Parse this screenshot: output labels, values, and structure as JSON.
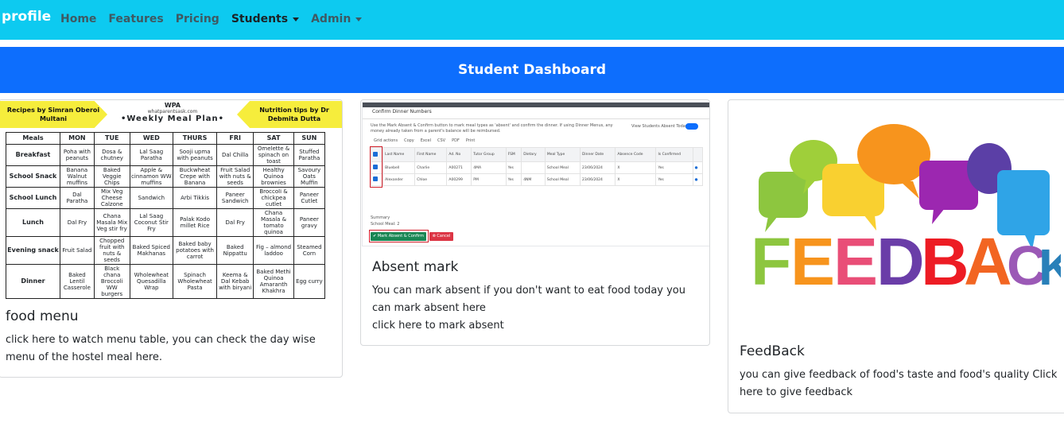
{
  "navbar": {
    "brand": "profile",
    "links": [
      {
        "label": "Home"
      },
      {
        "label": "Features"
      },
      {
        "label": "Pricing"
      },
      {
        "label": "Students"
      },
      {
        "label": "Admin"
      }
    ]
  },
  "banner": {
    "title": "Student Dashboard"
  },
  "cards": [
    {
      "title": "food menu",
      "text": "click here to watch menu table, you can check the day wise menu of the hostel meal here.",
      "image": {
        "left_banner": "Recipes by Simran Oberoi Multani",
        "right_banner": "Nutrition tips by Dr Debmita Dutta",
        "brand": "WPA",
        "site": "whatparentsask.com",
        "plan_title": "•Weekly Meal Plan•",
        "headers": [
          "Meals",
          "MON",
          "TUE",
          "WED",
          "THURS",
          "FRI",
          "SAT",
          "SUN"
        ],
        "rows": [
          [
            "Breakfast",
            "Poha with peanuts",
            "Dosa & chutney",
            "Lal Saag Paratha",
            "Sooji upma with peanuts",
            "Dal Chilla",
            "Omelette & spinach on toast",
            "Stuffed Paratha"
          ],
          [
            "School Snack",
            "Banana Walnut muffins",
            "Baked Veggie Chips",
            "Apple & cinnamon WW muffins",
            "Buckwheat Crepe with Banana",
            "Fruit Salad with nuts & seeds",
            "Healthy Quinoa brownies",
            "Savoury Oats Muffin"
          ],
          [
            "School Lunch",
            "Dal Paratha",
            "Mix Veg Cheese Calzone",
            "Sandwich",
            "Arbi Tikkis",
            "Paneer Sandwich",
            "Broccoli & chickpea cutlet",
            "Paneer Cutlet"
          ],
          [
            "Lunch",
            "Dal Fry",
            "Chana Masala Mix Veg stir fry",
            "Lal Saag Coconut Stir Fry",
            "Palak Kodo millet Rice",
            "Dal Fry",
            "Chana Masala & tomato quinoa",
            "Paneer gravy"
          ],
          [
            "Evening snack",
            "Fruit Salad",
            "Chopped fruit with nuts & seeds",
            "Baked Spiced Makhanas",
            "Baked baby potatoes with carrot",
            "Baked Nippattu",
            "Fig – almond laddoo",
            "Steamed Corn"
          ],
          [
            "Dinner",
            "Baked Lentil Casserole",
            "Black chana Broccoli WW burgers",
            "Wholewheat Quesadilla Wrap",
            "Spinach Wholewheat Pasta",
            "Keema & Dal Kebab with biryani",
            "Baked Methi Quinoa Amaranth Khakhra",
            "Egg curry"
          ]
        ]
      }
    },
    {
      "title": "Absent mark",
      "text": "You can mark absent if you don't want to eat food today you can mark absent here",
      "text2": "click here to mark absent",
      "image": {
        "dialog_title": "Confirm Dinner Numbers",
        "description": "Use the Mark Absent & Confirm button to mark meal types as 'absent' and confirm the dinner. If using Dinner Menus, any money already taken from a parent's balance will be reimbursed.",
        "toggle_label": "View Students Absent Today",
        "tabs": [
          "Grid actions",
          "Copy",
          "Excel",
          "CSV",
          "PDF",
          "Print"
        ],
        "columns": [
          "",
          "Last Name",
          "First Name",
          "Ad. No",
          "Tutor Group",
          "FSM",
          "Dietary",
          "Meal Type",
          "Dinner Date",
          "Absence Code",
          "Is Confirmed",
          ""
        ],
        "rows": [
          [
            "",
            "Bluebell",
            "Charlie",
            "A00271",
            "4MA",
            "Yes",
            "",
            "School Meal",
            "23/06/2024",
            "X",
            "Yes",
            ""
          ],
          [
            "",
            "Alexander",
            "Chloe",
            "A00299",
            "PM",
            "Yes",
            "4NM",
            "School Meal",
            "23/06/2024",
            "X",
            "Yes",
            ""
          ]
        ],
        "summary_label": "Summary",
        "summary_value": "School Meal: 2",
        "confirm_button": "✔ Mark Absent & Confirm",
        "cancel_button": "⊗ Cancel"
      }
    },
    {
      "title": "FeedBack",
      "text": "you can give feedback of food's taste and food's quality Click here to give feedback",
      "image": {
        "word": "FEEDBACK",
        "letter_colors": [
          "#8dc63f",
          "#f7941d",
          "#e94e77",
          "#1c75bc",
          "#ed1c24",
          "#f26522",
          "#9b59b6",
          "#2980b9"
        ],
        "bubble_colors": [
          "#8dc63f",
          "#f9b233",
          "#f7941d",
          "#9c27b0",
          "#3b7dd8",
          "#2fa4e7",
          "#f5d033",
          "#69bf4a"
        ]
      }
    }
  ]
}
